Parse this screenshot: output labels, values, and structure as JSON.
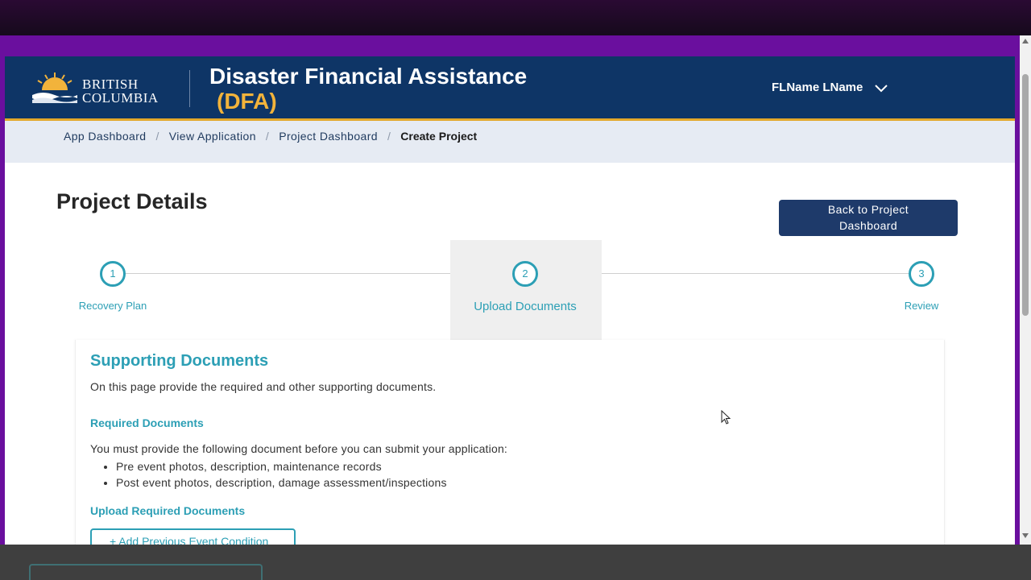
{
  "header": {
    "logo_line1": "BRITISH",
    "logo_line2": "COLUMBIA",
    "title": "Disaster Financial Assistance",
    "subtitle": "(DFA)",
    "user_name": "FLName LName"
  },
  "breadcrumb": {
    "items": [
      "App Dashboard",
      "View Application",
      "Project Dashboard"
    ],
    "separator": "/",
    "current": "Create Project"
  },
  "page": {
    "title": "Project Details",
    "back_button_line1": "Back to Project",
    "back_button_line2": "Dashboard"
  },
  "stepper": {
    "steps": [
      {
        "number": "1",
        "label": "Recovery Plan"
      },
      {
        "number": "2",
        "label": "Upload Documents"
      },
      {
        "number": "3",
        "label": "Review"
      }
    ],
    "active_step": 2
  },
  "documents": {
    "title": "Supporting Documents",
    "intro": "On this page provide the required and other supporting documents.",
    "required_heading": "Required Documents",
    "required_text": "You must provide the following document before you can submit your application:",
    "required_items": [
      "Pre event photos, description, maintenance records",
      "Post event photos, description, damage assessment/inspections"
    ],
    "upload_heading": "Upload Required Documents",
    "add_button": "+ Add Previous Event Condition"
  },
  "colors": {
    "header_bg": "#0e3566",
    "accent_gold": "#f2b33b",
    "teal": "#2c9fb5",
    "frame_purple": "#6a0f9e"
  }
}
